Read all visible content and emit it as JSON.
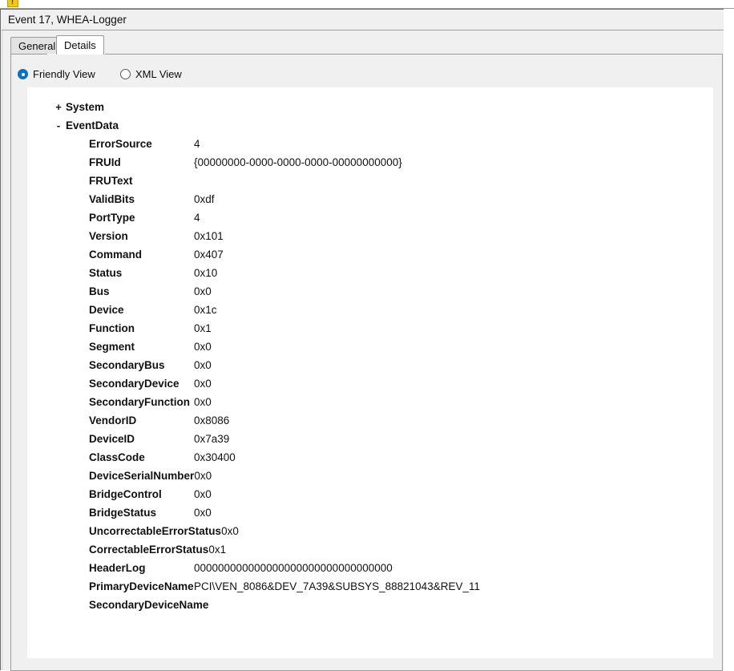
{
  "top_strip": {
    "warning_icon": "warning-icon",
    "ghost_left": "",
    "ghost_mid": "",
    "ghost_right": ""
  },
  "window": {
    "title": "Event 17, WHEA-Logger"
  },
  "tabs": [
    {
      "label": "General",
      "selected": false
    },
    {
      "label": "Details",
      "selected": true
    }
  ],
  "view_options": [
    {
      "label": "Friendly View",
      "checked": true
    },
    {
      "label": "XML View",
      "checked": false
    }
  ],
  "tree": {
    "nodes": [
      {
        "toggle": "+",
        "name": "System"
      },
      {
        "toggle": "-",
        "name": "EventData"
      }
    ],
    "fields": [
      {
        "name": "ErrorSource",
        "value": "4"
      },
      {
        "name": "FRUId",
        "value": "{00000000-0000-0000-0000-00000000000}"
      },
      {
        "name": "FRUText",
        "value": ""
      },
      {
        "name": "ValidBits",
        "value": "0xdf"
      },
      {
        "name": "PortType",
        "value": "4"
      },
      {
        "name": "Version",
        "value": "0x101"
      },
      {
        "name": "Command",
        "value": "0x407"
      },
      {
        "name": "Status",
        "value": "0x10"
      },
      {
        "name": "Bus",
        "value": "0x0"
      },
      {
        "name": "Device",
        "value": "0x1c"
      },
      {
        "name": "Function",
        "value": "0x1"
      },
      {
        "name": "Segment",
        "value": "0x0"
      },
      {
        "name": "SecondaryBus",
        "value": "0x0"
      },
      {
        "name": "SecondaryDevice",
        "value": "0x0"
      },
      {
        "name": "SecondaryFunction",
        "value": "0x0"
      },
      {
        "name": "VendorID",
        "value": "0x8086"
      },
      {
        "name": "DeviceID",
        "value": "0x7a39"
      },
      {
        "name": "ClassCode",
        "value": "0x30400"
      },
      {
        "name": "DeviceSerialNumber",
        "value": "0x0"
      },
      {
        "name": "BridgeControl",
        "value": "0x0"
      },
      {
        "name": "BridgeStatus",
        "value": "0x0"
      },
      {
        "name": "UncorrectableErrorStatus",
        "value": "0x0"
      },
      {
        "name": "CorrectableErrorStatus",
        "value": "0x1"
      },
      {
        "name": "HeaderLog",
        "value": "000000000000000000000000000000000"
      },
      {
        "name": "PrimaryDeviceName",
        "value": "PCI\\VEN_8086&DEV_7A39&SUBSYS_88821043&REV_11"
      },
      {
        "name": "SecondaryDeviceName",
        "value": ""
      }
    ]
  },
  "colors": {
    "accent": "#0a70c8",
    "dialog_bg": "#f0f0f0",
    "content_bg": "#ffffff",
    "warning_icon": "#f2c51c"
  }
}
